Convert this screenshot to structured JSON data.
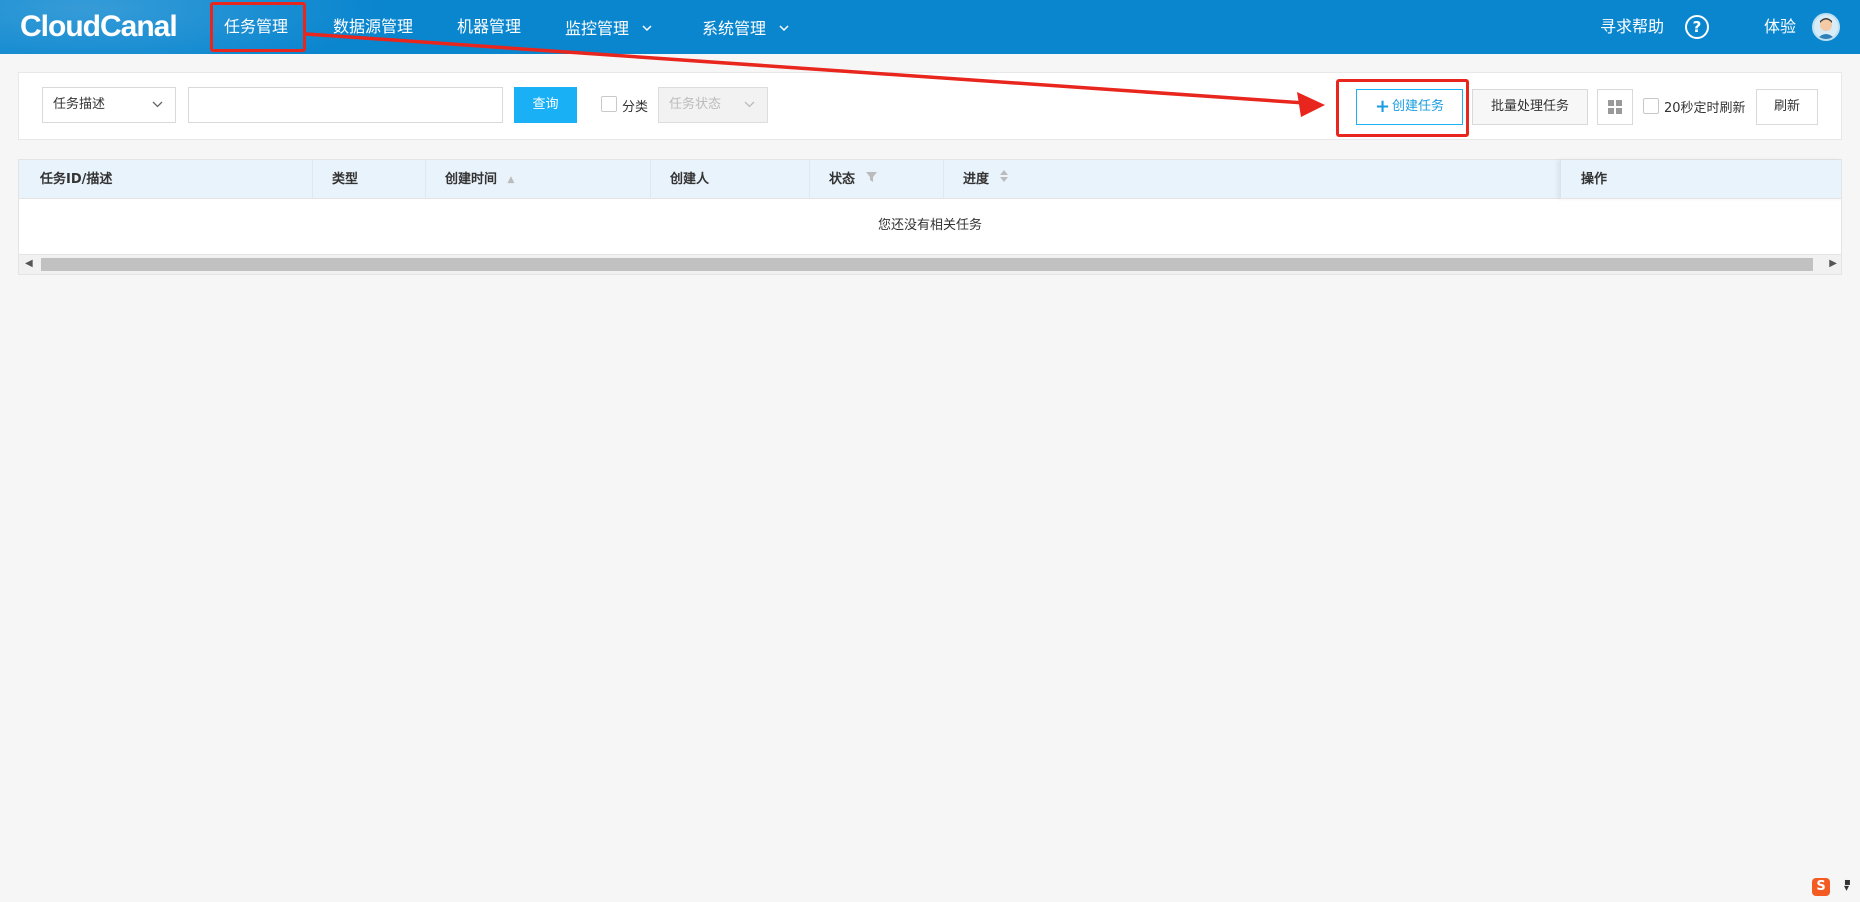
{
  "brand": {
    "logo": "CloudCanal"
  },
  "nav": {
    "items": [
      {
        "label": "任务管理",
        "active": true
      },
      {
        "label": "数据源管理"
      },
      {
        "label": "机器管理"
      },
      {
        "label": "监控管理",
        "has_dropdown": true
      },
      {
        "label": "系统管理",
        "has_dropdown": true
      }
    ],
    "help_label": "寻求帮助",
    "help_icon": "question-circle-icon",
    "user_label": "体验"
  },
  "filters": {
    "field_select": "任务描述",
    "search_value": "",
    "query_label": "查询",
    "category_label": "分类",
    "status_select": "任务状态",
    "create_label": "创建任务",
    "batch_label": "批量处理任务",
    "auto_refresh_label": "20秒定时刷新",
    "refresh_label": "刷新"
  },
  "table": {
    "columns": [
      "任务ID/描述",
      "类型",
      "创建时间",
      "创建人",
      "状态",
      "进度",
      "操作"
    ],
    "empty_text": "您还没有相关任务"
  },
  "colors": {
    "header_bg": "#0a86cf",
    "primary": "#1ab0f5",
    "annotation": "#e8261e"
  }
}
